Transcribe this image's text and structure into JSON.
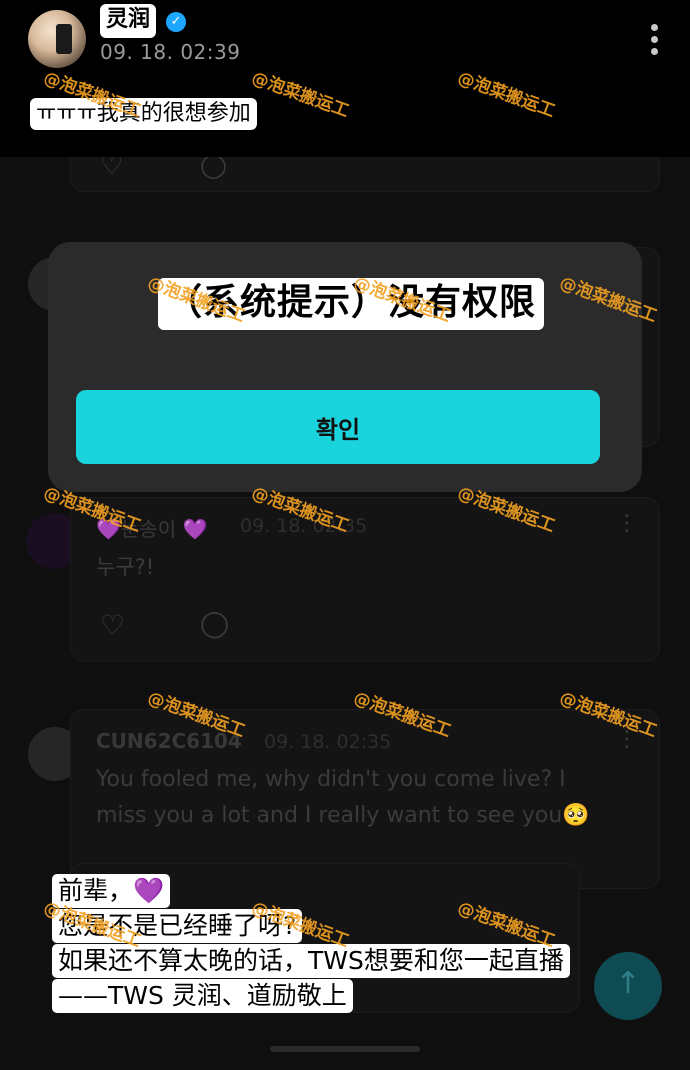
{
  "top_post": {
    "author": "灵润",
    "date": "09. 18. 02:39",
    "message": "ㅠㅠㅠ我真的很想参加"
  },
  "dialog": {
    "title": "（系统提示）没有权限",
    "confirm_label": "확인"
  },
  "background_comments": [
    {
      "author": "💜눈송이 💜",
      "date": "09. 18. 02:35",
      "text": "누구?!"
    },
    {
      "author": "CUN62C6104",
      "date": "09. 18. 02:35",
      "text_line1": "You fooled me, why didn't you come live? I",
      "text_line2": "miss you a lot and I really want to see you🥺"
    }
  ],
  "caption": {
    "line1": "前辈，",
    "line1_emoji": "💜",
    "line2": "您是不是已经睡了呀?",
    "line3": "如果还不算太晚的话，TWS想要和您一起直播",
    "line4": "——TWS 灵润、道励敬上"
  },
  "watermark": "@泡菜搬运工",
  "colors": {
    "accent": "#19d4dd",
    "verified": "#1ea7ff",
    "watermark": "#f2a020",
    "heart": "#a855f7"
  },
  "icons": [
    "verified-badge-icon",
    "more-vertical-icon",
    "heart-icon",
    "comment-icon",
    "arrow-up-icon"
  ]
}
